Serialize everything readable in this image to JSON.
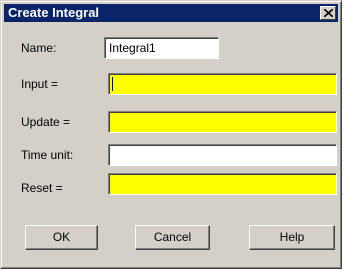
{
  "window": {
    "title": "Create Integral",
    "close_glyph": "close-icon"
  },
  "form": {
    "name_label": "Name:",
    "name_value": "Integral1",
    "input_label": "Input =",
    "input_value": "",
    "update_label": "Update =",
    "update_value": "",
    "timeunit_label": "Time unit:",
    "timeunit_value": "",
    "reset_label": "Reset =",
    "reset_value": ""
  },
  "buttons": {
    "ok": "OK",
    "cancel": "Cancel",
    "help": "Help"
  },
  "colors": {
    "title_bar": "#0a246a",
    "dialog_bg": "#d4d0c8",
    "required_field": "#ffff00"
  }
}
